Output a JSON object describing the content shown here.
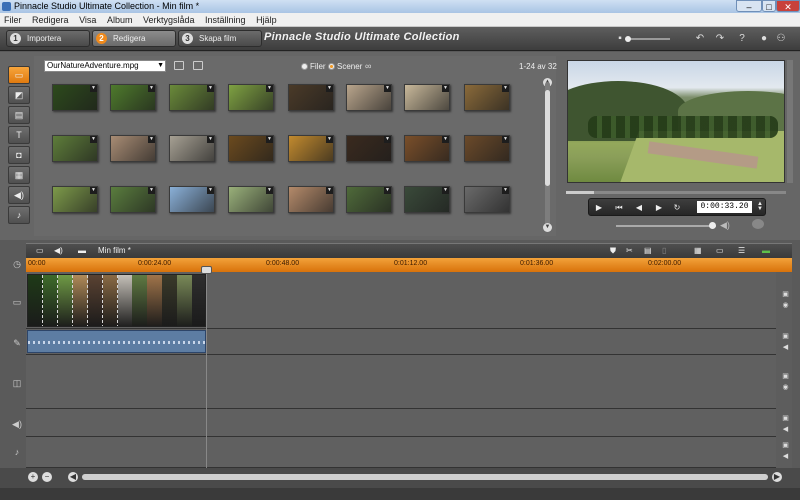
{
  "window": {
    "title": "Pinnacle Studio Ultimate Collection - Min film *",
    "controls": [
      "–",
      "□",
      "✕"
    ]
  },
  "menu": [
    "Filer",
    "Redigera",
    "Visa",
    "Album",
    "Verktygslåda",
    "Inställning",
    "Hjälp"
  ],
  "steps": [
    {
      "num": "1",
      "label": "Importera"
    },
    {
      "num": "2",
      "label": "Redigera"
    },
    {
      "num": "3",
      "label": "Skapa film"
    }
  ],
  "app_title": "Pinnacle Studio Ultimate Collection",
  "toolbar_icons": [
    "undo-icon",
    "redo-icon",
    "help-icon",
    "tip-icon",
    "account-icon"
  ],
  "library": {
    "file_selected": "OurNatureAdventure.mpg",
    "view_options": [
      "Filer",
      "Scener"
    ],
    "selected_view": "Scener",
    "count": "1-24 av 32",
    "left_tabs": [
      "video-icon",
      "photo-icon",
      "transitions-icon",
      "title-icon",
      "camera-icon",
      "menu-icon",
      "audio-icon",
      "music-icon"
    ]
  },
  "thumb_colors": [
    [
      "#2d4a1c",
      "#4e7a2c",
      "#6a8a3a",
      "#7ea142",
      "#4a3a28",
      "#b9a58c",
      "#c8b89a",
      "#8a6a3a"
    ],
    [
      "#5e7d3a",
      "#a88c74",
      "#a6a093",
      "#6b4a1e",
      "#c28a2e",
      "#3a2a1e",
      "#7a4f2a",
      "#6b4a2a"
    ],
    [
      "#7d9a4a",
      "#5a7d3e",
      "#8ab0d8",
      "#99b07a",
      "#b48a6a",
      "#4f6a3a",
      "#3a4a3a",
      "#6a6a6a"
    ]
  ],
  "player": {
    "timecode": "0:00:33.20",
    "controls": [
      "play-icon",
      "skip-start-icon",
      "step-back-icon",
      "step-forward-icon",
      "loop-icon"
    ]
  },
  "timeline": {
    "project_name": "Min film *",
    "ruler": [
      "00:00",
      "0:00:24.00",
      "0:00:48.00",
      "0:01:12.00",
      "0:01:36.00",
      "0:02:00.00"
    ],
    "clip_colors": [
      "#1f3a18",
      "#3e6b2a",
      "#6f9a45",
      "#b08a58",
      "#5a4232",
      "#8a6a44",
      "#c5c0b8",
      "#5f7a42",
      "#a0744a",
      "#3a3a2a",
      "#7a8a58",
      "#2e2e2e"
    ]
  }
}
